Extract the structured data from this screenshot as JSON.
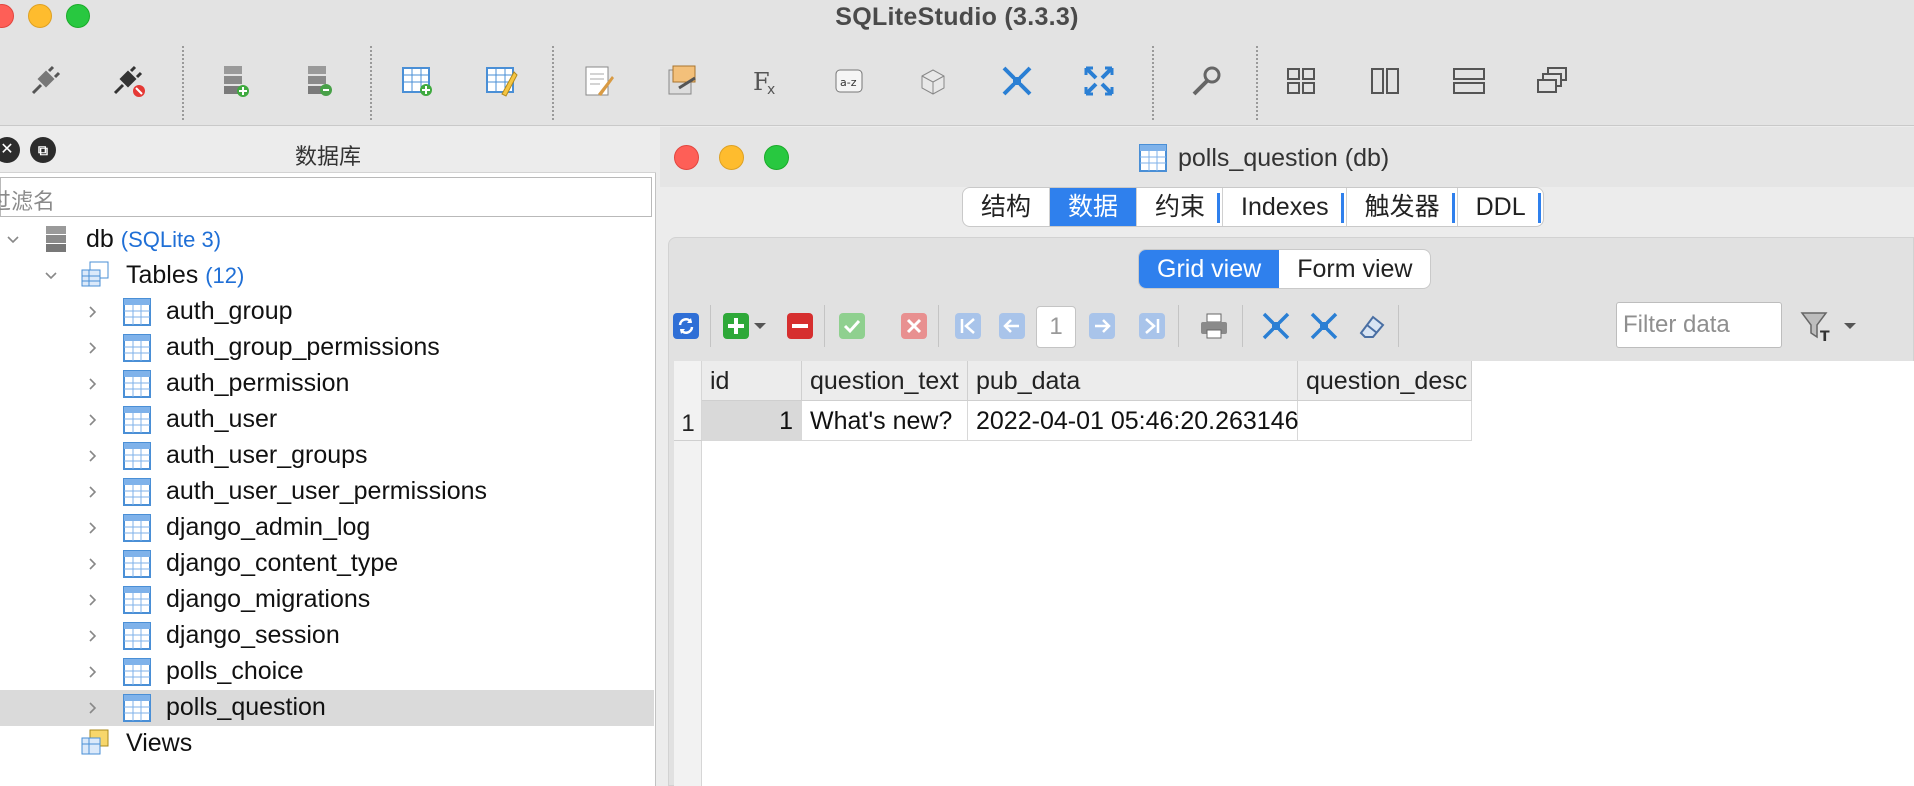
{
  "app": {
    "title": "SQLiteStudio (3.3.3)"
  },
  "toolbar": {
    "buttons": [
      "connect-db-icon",
      "disconnect-db-icon",
      "add-database-icon",
      "edit-database-icon",
      "create-table-icon",
      "edit-table-icon",
      "sql-editor-icon",
      "import-icon",
      "function-editor-icon",
      "collation-icon",
      "extension-icon",
      "collapse-icon",
      "expand-icon",
      "config-wrench-icon",
      "tile-icon",
      "tile-vertical-icon",
      "tile-horizontal-icon",
      "cascade-icon"
    ]
  },
  "db_panel": {
    "title": "数据库",
    "filter_placeholder": "过滤名",
    "db_name": "db",
    "db_type": "(SQLite 3)",
    "tables_label": "Tables",
    "tables_count": "(12)",
    "tables": [
      "auth_group",
      "auth_group_permissions",
      "auth_permission",
      "auth_user",
      "auth_user_groups",
      "auth_user_user_permissions",
      "django_admin_log",
      "django_content_type",
      "django_migrations",
      "django_session",
      "polls_choice",
      "polls_question"
    ],
    "views_label": "Views"
  },
  "window": {
    "title": "polls_question (db)",
    "tabs": [
      "结构",
      "数据",
      "约束",
      "Indexes",
      "触发器",
      "DDL"
    ],
    "active_tab": "数据",
    "views": [
      "Grid view",
      "Form view"
    ],
    "page_number": "1",
    "filter_placeholder": "Filter data"
  },
  "grid": {
    "columns": [
      "id",
      "question_text",
      "pub_data",
      "question_desc"
    ],
    "rows": [
      {
        "rownum": "1",
        "id": "1",
        "question_text": "What's new?",
        "pub_data": "2022-04-01 05:46:20.263146",
        "question_desc": ""
      }
    ]
  },
  "colors": {
    "accent": "#2f80ed",
    "selection": "#dadada",
    "close": "#fe5f57",
    "minimize": "#febc2e",
    "maximize": "#28c840"
  }
}
